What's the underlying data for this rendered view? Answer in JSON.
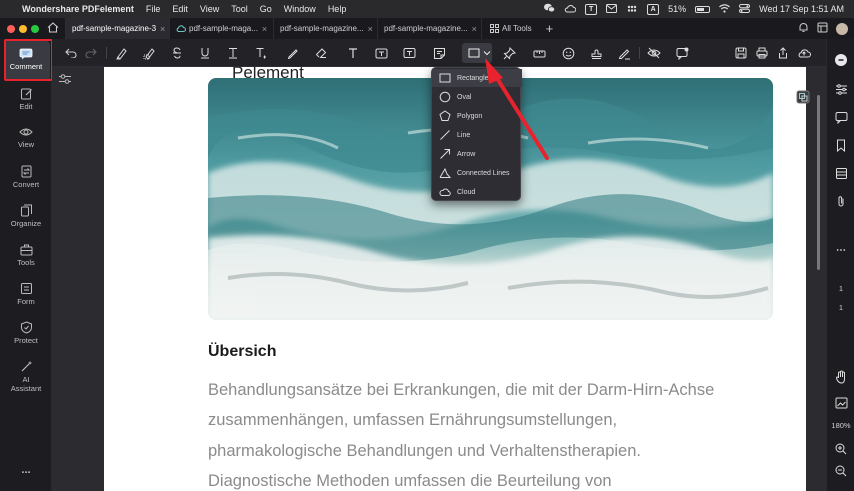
{
  "menubar": {
    "app_name": "Wondershare PDFelement",
    "menus": [
      "File",
      "Edit",
      "View",
      "Tool",
      "Go",
      "Window",
      "Help"
    ],
    "status": {
      "battery": "51%",
      "input_source": "A",
      "datetime": "Wed 17 Sep  1:51 AM"
    }
  },
  "tabs": [
    {
      "label": "pdf-sample-magazine-3",
      "active": true
    },
    {
      "label": "pdf-sample-maga...",
      "active": false,
      "cloud": true
    },
    {
      "label": "pdf-sample-magazine...",
      "active": false
    },
    {
      "label": "pdf-sample-magazine...",
      "active": false
    }
  ],
  "all_tools_label": "All Tools",
  "left_sidebar": [
    {
      "label": "Comment",
      "icon": "comment-icon",
      "active": true
    },
    {
      "label": "Edit",
      "icon": "edit-icon"
    },
    {
      "label": "View",
      "icon": "eye-icon"
    },
    {
      "label": "Convert",
      "icon": "convert-icon"
    },
    {
      "label": "Organize",
      "icon": "organize-icon"
    },
    {
      "label": "Tools",
      "icon": "toolbox-icon"
    },
    {
      "label": "Form",
      "icon": "form-icon"
    },
    {
      "label": "Protect",
      "icon": "shield-icon"
    },
    {
      "label": "AI Assistant",
      "icon": "ai-sparkle-icon"
    }
  ],
  "more_label": "...",
  "shape_menu": {
    "items": [
      {
        "label": "Rectangle",
        "icon": "rectangle-icon",
        "highlighted": true
      },
      {
        "label": "Oval",
        "icon": "oval-icon"
      },
      {
        "label": "Polygon",
        "icon": "polygon-icon"
      },
      {
        "label": "Line",
        "icon": "line-icon"
      },
      {
        "label": "Arrow",
        "icon": "arrow-icon"
      },
      {
        "label": "Connected Lines",
        "icon": "connected-lines-icon"
      },
      {
        "label": "Cloud",
        "icon": "cloud-icon"
      }
    ]
  },
  "document": {
    "heading_partial": "Pelement",
    "section_title": "Übersich",
    "paragraph_lines": [
      "Behandlungsansätze bei Erkrankungen, die mit der Darm-Hirn-Achse",
      "zusammenhängen, umfassen Ernährungsumstellungen,",
      "pharmakologische Behandlungen und Verhaltenstherapien.",
      "Diagnostische Methoden umfassen die Beurteilung von"
    ]
  },
  "right_sidebar": {
    "page_current": "1",
    "page_total": "1",
    "zoom": "180%"
  },
  "colors": {
    "annotation_red": "#e8232d",
    "sidebar_bg": "#1c1c21",
    "canvas_bg": "#2b2b30"
  }
}
